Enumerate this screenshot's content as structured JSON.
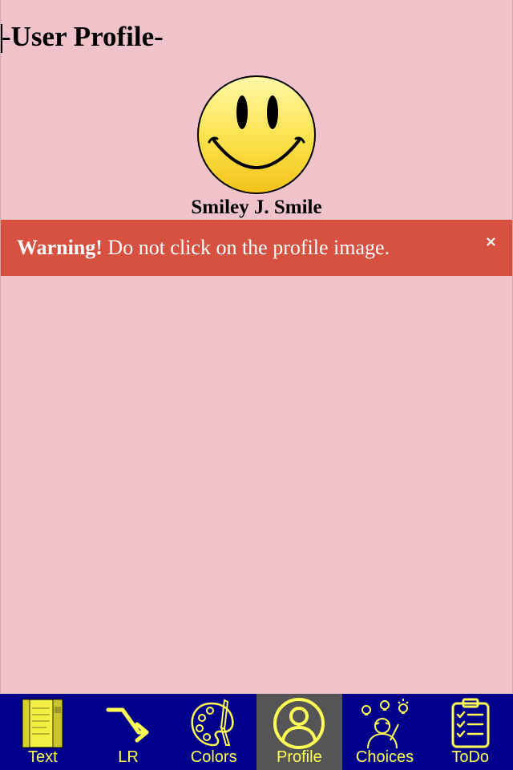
{
  "page": {
    "title": "-User Profile-"
  },
  "profile": {
    "name": "Smiley J. Smile",
    "image_icon": "smiley-face-icon"
  },
  "alert": {
    "strong": "Warning!",
    "message": " Do not click on the profile image.",
    "close_label": "×",
    "background_color": "#d65140"
  },
  "nav": {
    "background_color": "#00008b",
    "active_color": "#555555",
    "label_color": "#ffff55",
    "items": [
      {
        "label": "Text",
        "icon": "notes-icon",
        "active": false
      },
      {
        "label": "LR",
        "icon": "arrow-icon",
        "active": false
      },
      {
        "label": "Colors",
        "icon": "palette-icon",
        "active": false
      },
      {
        "label": "Profile",
        "icon": "user-icon",
        "active": true
      },
      {
        "label": "Choices",
        "icon": "ideas-icon",
        "active": false
      },
      {
        "label": "ToDo",
        "icon": "checklist-icon",
        "active": false
      }
    ]
  },
  "colors": {
    "page_background": "#f0c3cb"
  }
}
